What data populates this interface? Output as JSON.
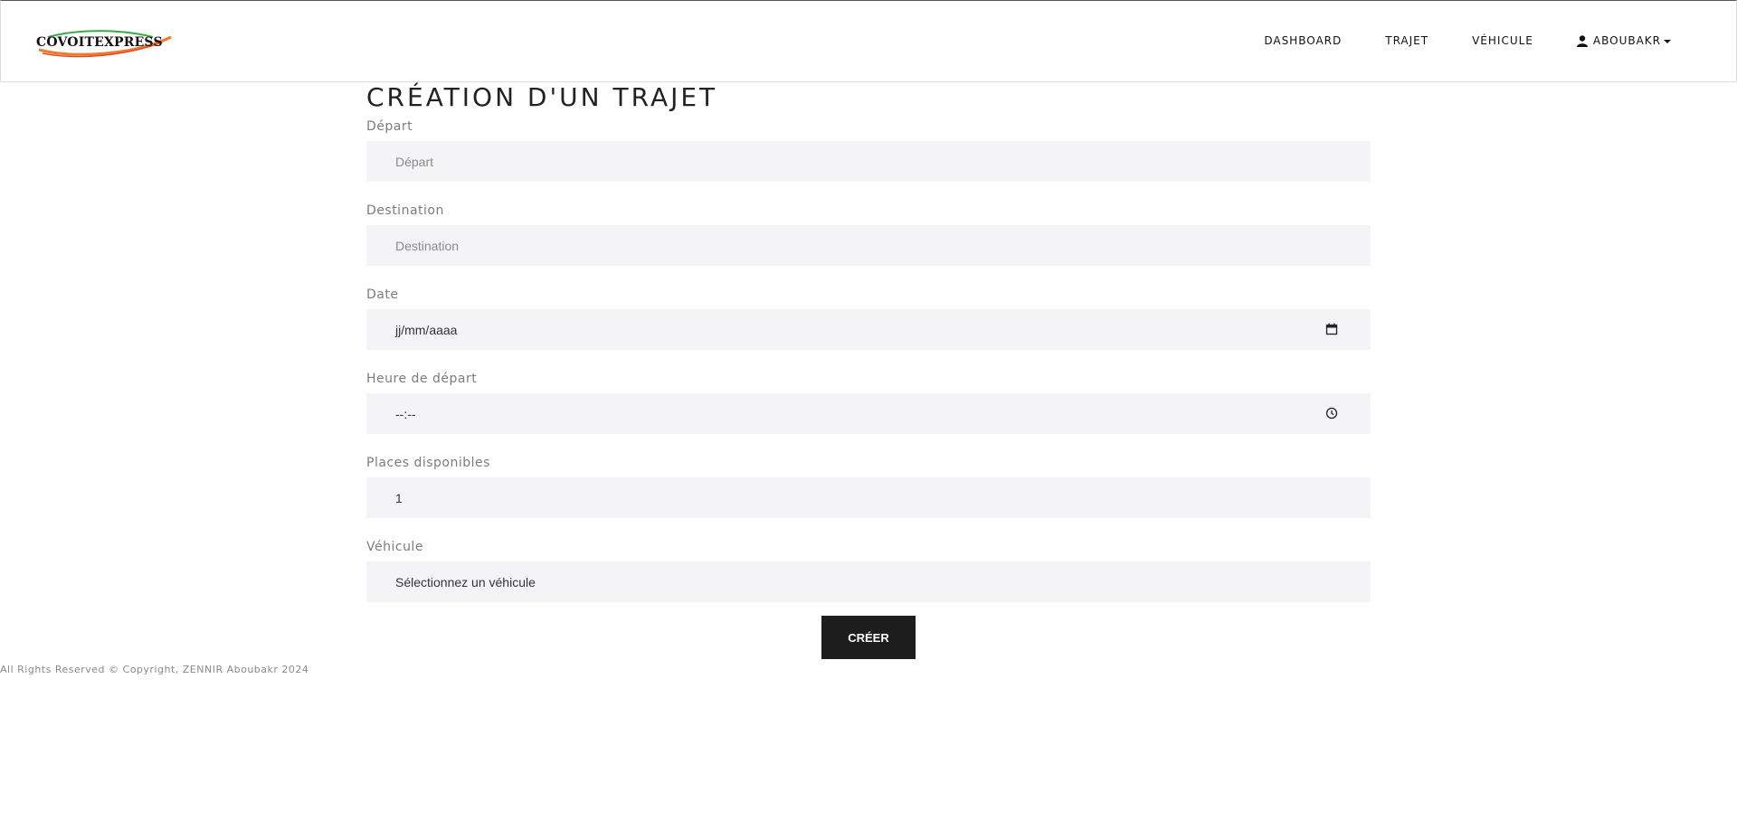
{
  "header": {
    "logo_text": "COVOITEXPRESS",
    "nav": {
      "dashboard": "DASHBOARD",
      "trajet": "TRAJET",
      "vehicule": "VÉHICULE",
      "user": "ABOUBAKR"
    },
    "icons": {
      "user": "user-icon",
      "dropdown": "caret-down-icon"
    }
  },
  "page": {
    "title": "CRÉATION D'UN TRAJET"
  },
  "form": {
    "depart": {
      "label": "Départ",
      "placeholder": "Départ"
    },
    "destination": {
      "label": "Destination",
      "placeholder": "Destination"
    },
    "date": {
      "label": "Date",
      "placeholder": "jj/mm/aaaa",
      "icon": "calendar-icon"
    },
    "heure": {
      "label": "Heure de départ",
      "placeholder": "--:--",
      "icon": "clock-icon"
    },
    "places": {
      "label": "Places disponibles",
      "value": "1"
    },
    "vehicule": {
      "label": "Véhicule",
      "selected": "Sélectionnez un véhicule"
    },
    "submit_label": "CRÉER"
  },
  "footer": {
    "text": "All Rights Reserved © Copyright, ZENNIR Aboubakr 2024"
  },
  "colors": {
    "field_bg": "#f4f4f6",
    "button_bg": "#1d1d1d",
    "logo_orange": "#f07a2a",
    "logo_green": "#3aa84a"
  }
}
